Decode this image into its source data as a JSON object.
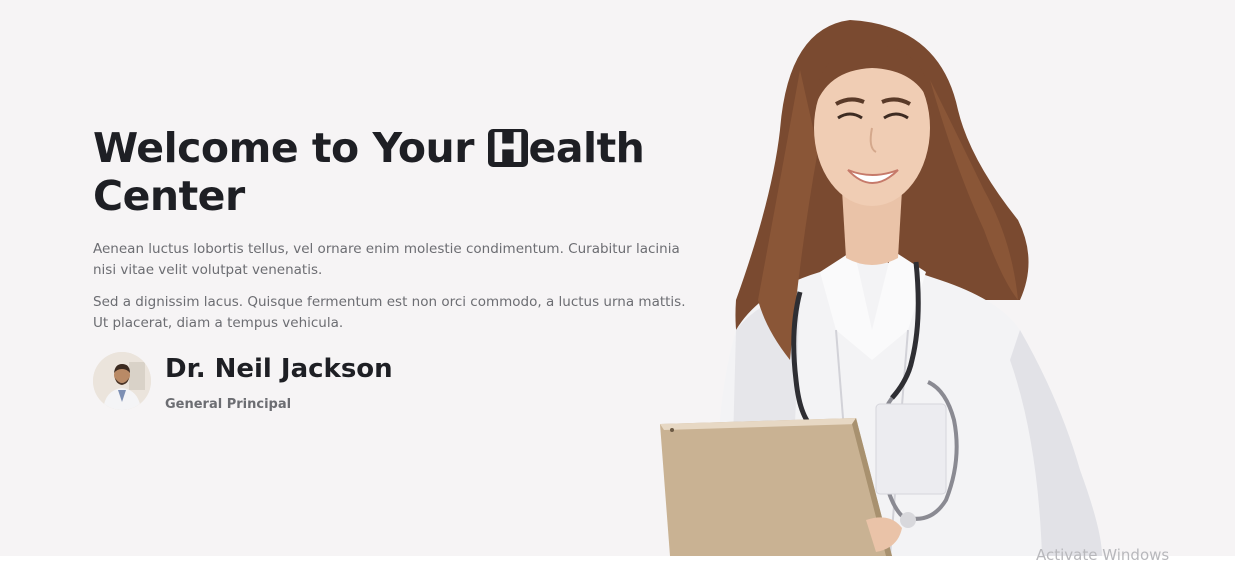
{
  "hero": {
    "title_prefix": "Welcome to Your ",
    "title_highlight": "H",
    "title_suffix": "ealth",
    "title_line2": "Center",
    "paragraph1": "Aenean luctus lobortis tellus, vel ornare enim molestie condimentum. Curabitur lacinia nisi vitae velit volutpat venenatis.",
    "paragraph2": "Sed a dignissim lacus. Quisque fermentum est non orci commodo, a luctus urna mattis. Ut placerat, diam a tempus vehicula."
  },
  "author": {
    "name": "Dr. Neil Jackson",
    "role": "General Principal"
  },
  "overlay": {
    "watermark": "Activate Windows"
  },
  "colors": {
    "background": "#f6f4f5",
    "heading": "#1e1f24",
    "body_text": "#6c6d72"
  }
}
